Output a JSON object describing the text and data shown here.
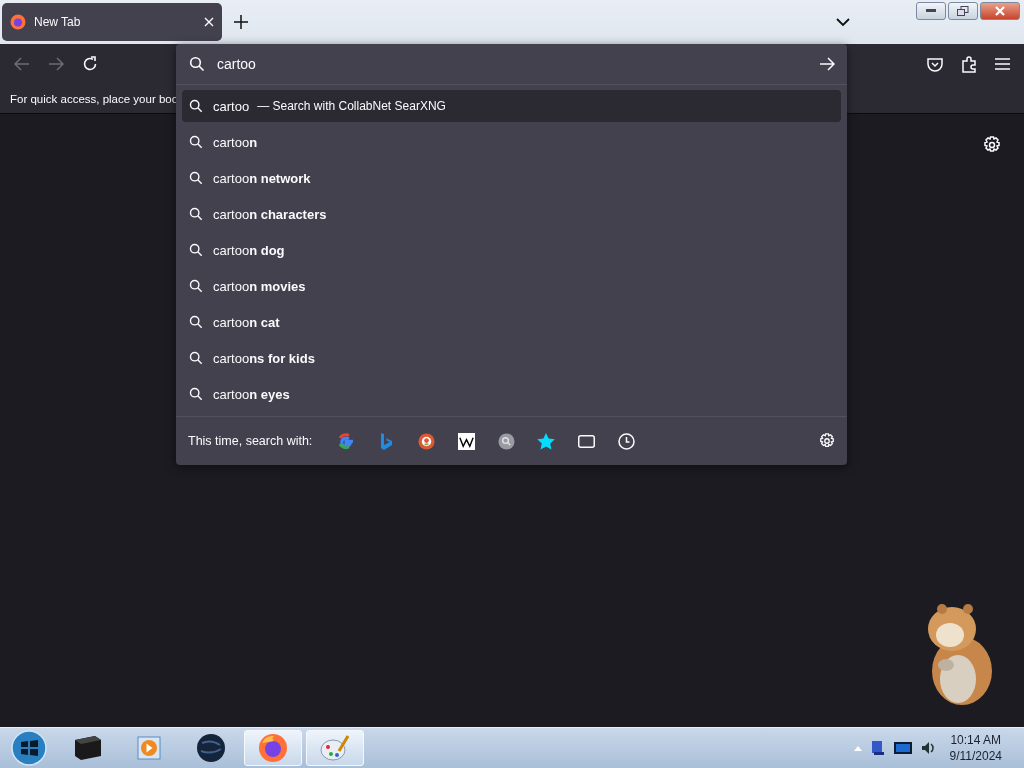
{
  "tabs": [
    {
      "label": "New Tab",
      "selected": true
    }
  ],
  "bookmarks_bar": {
    "text": "For quick access, place your boo"
  },
  "address": {
    "value": "cartoo"
  },
  "suggestions": [
    {
      "text": "cartoo",
      "hint": "— Search with CollabNet SearXNG",
      "selected": true
    },
    {
      "text": "cartoo**n**",
      "selected": false
    },
    {
      "text": "cartoo**n network**",
      "selected": false
    },
    {
      "text": "cartoo**n characters**",
      "selected": false
    },
    {
      "text": "cartoo**n dog**",
      "selected": false
    },
    {
      "text": "cartoo**n movies**",
      "selected": false
    },
    {
      "text": "cartoo**n cat**",
      "selected": false
    },
    {
      "text": "cartoo**ns for kids**",
      "selected": false
    },
    {
      "text": "cartoo**n eyes**",
      "selected": false
    }
  ],
  "search_with": {
    "label": "This time, search with:",
    "engines": [
      {
        "kind": "google"
      },
      {
        "kind": "bing"
      },
      {
        "kind": "duck"
      },
      {
        "kind": "wiki"
      },
      {
        "kind": "searx"
      },
      {
        "kind": "bookmarks"
      },
      {
        "kind": "tabs"
      },
      {
        "kind": "history"
      }
    ]
  },
  "taskbar": {
    "apps": [
      {
        "kind": "box",
        "selected": false
      },
      {
        "kind": "player",
        "selected": false
      },
      {
        "kind": "globe",
        "selected": false
      },
      {
        "kind": "firefox",
        "selected": true
      },
      {
        "kind": "paint",
        "selected": true
      }
    ],
    "time": "10:14 AM",
    "date": "9/11/2024"
  }
}
